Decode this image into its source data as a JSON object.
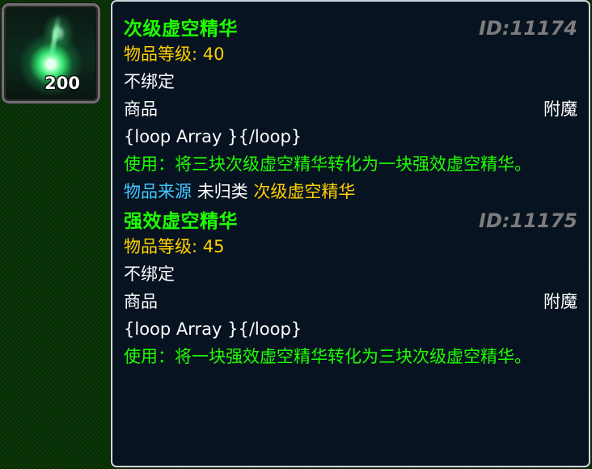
{
  "icon": {
    "name": "lesser-nether-essence-icon",
    "stack_count": "200"
  },
  "tooltip": {
    "items": [
      {
        "name": "次级虚空精华",
        "id_label": "ID:11174",
        "item_level_label": "物品等级:",
        "item_level_value": "40",
        "binding": "不绑定",
        "category_left": "商品",
        "category_right": "附魔",
        "loop_text": "{loop Array }{/loop}",
        "use_text": "使用：将三块次级虚空精华转化为一块强效虚空精华。",
        "source_label": "物品来源",
        "source_category": "未归类",
        "source_item": "次级虚空精华"
      },
      {
        "name": "强效虚空精华",
        "id_label": "ID:11175",
        "item_level_label": "物品等级:",
        "item_level_value": "45",
        "binding": "不绑定",
        "category_left": "商品",
        "category_right": "附魔",
        "loop_text": "{loop Array }{/loop}",
        "use_text": "使用：将一块强效虚空精华转化为三块次级虚空精华。"
      }
    ]
  },
  "colors": {
    "title_green": "#1eff00",
    "id_gray": "#7c7c7c",
    "level_gold": "#ffd100",
    "source_blue": "#44c7ff",
    "tooltip_bg": "#071320",
    "border": "#cfd6df"
  }
}
